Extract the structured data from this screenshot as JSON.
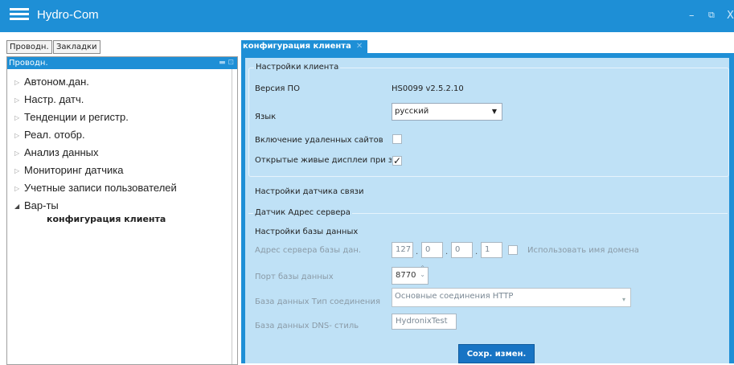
{
  "window": {
    "title": "Hydro-Com",
    "controls": {
      "minimize": "–",
      "restore": "⧉",
      "close": "X"
    }
  },
  "left_tabs": [
    "Проводн.",
    "Закладки"
  ],
  "tree": {
    "header": "Проводн.",
    "items": [
      {
        "label": "Автоном.дан.",
        "expanded": false
      },
      {
        "label": "Настр. датч.",
        "expanded": false
      },
      {
        "label": "Тенденции и регистр.",
        "expanded": false
      },
      {
        "label": "Реал. отобр.",
        "expanded": false
      },
      {
        "label": "Анализ данных",
        "expanded": false
      },
      {
        "label": "Мониторинг датчика",
        "expanded": false
      },
      {
        "label": "Учетные записи пользователей",
        "expanded": false
      },
      {
        "label": "Вар-ты",
        "expanded": true
      }
    ],
    "subitem": "конфигурация клиента"
  },
  "doc_tab": {
    "label": "конфигурация клиента",
    "close": "✕"
  },
  "client_settings": {
    "legend": "Настройки клиента",
    "version_label": "Версия ПО",
    "version_value": "HS0099 v2.5.2.10",
    "language_label": "Язык",
    "language_value": "русский",
    "remote_sites_label": "Включение удаленных сайтов",
    "remote_sites_checked": false,
    "open_live_label": "Открытые живые дисплеи при запуске",
    "open_live_checked": true
  },
  "sensor_comm_label": "Настройки датчика связи",
  "server": {
    "legend": "Датчик Адрес сервера",
    "db_settings_label": "Настройки базы данных",
    "address_label": "Адрес сервера базы дан.",
    "ip": [
      "127",
      "0",
      "0",
      "1"
    ],
    "use_domain_label": "Использовать имя домена",
    "use_domain_checked": false,
    "port_label": "Порт базы данных",
    "port_value": "8770",
    "conn_type_label": "База данных Тип соединения",
    "conn_type_value": "Основные соединения HTTP",
    "dns_label": "База данных DNS- стиль",
    "dns_value": "HydronixTest"
  },
  "save_button": "Сохр. измен.",
  "colors": {
    "accent": "#1e8fd6",
    "panel": "#bfe1f6",
    "button": "#1874c4"
  }
}
